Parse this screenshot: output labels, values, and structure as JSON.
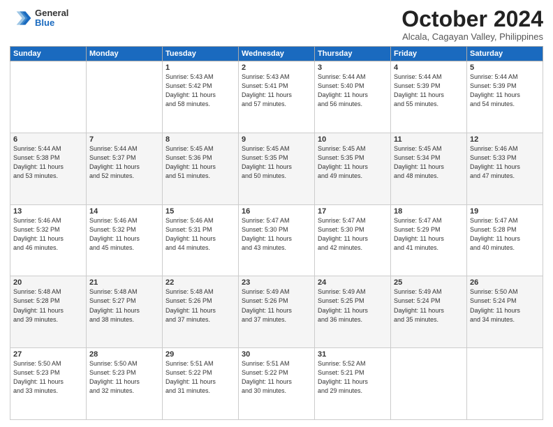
{
  "header": {
    "logo_general": "General",
    "logo_blue": "Blue",
    "month_title": "October 2024",
    "location": "Alcala, Cagayan Valley, Philippines"
  },
  "days_of_week": [
    "Sunday",
    "Monday",
    "Tuesday",
    "Wednesday",
    "Thursday",
    "Friday",
    "Saturday"
  ],
  "weeks": [
    [
      {
        "day": "",
        "info": ""
      },
      {
        "day": "",
        "info": ""
      },
      {
        "day": "1",
        "info": "Sunrise: 5:43 AM\nSunset: 5:42 PM\nDaylight: 11 hours\nand 58 minutes."
      },
      {
        "day": "2",
        "info": "Sunrise: 5:43 AM\nSunset: 5:41 PM\nDaylight: 11 hours\nand 57 minutes."
      },
      {
        "day": "3",
        "info": "Sunrise: 5:44 AM\nSunset: 5:40 PM\nDaylight: 11 hours\nand 56 minutes."
      },
      {
        "day": "4",
        "info": "Sunrise: 5:44 AM\nSunset: 5:39 PM\nDaylight: 11 hours\nand 55 minutes."
      },
      {
        "day": "5",
        "info": "Sunrise: 5:44 AM\nSunset: 5:39 PM\nDaylight: 11 hours\nand 54 minutes."
      }
    ],
    [
      {
        "day": "6",
        "info": "Sunrise: 5:44 AM\nSunset: 5:38 PM\nDaylight: 11 hours\nand 53 minutes."
      },
      {
        "day": "7",
        "info": "Sunrise: 5:44 AM\nSunset: 5:37 PM\nDaylight: 11 hours\nand 52 minutes."
      },
      {
        "day": "8",
        "info": "Sunrise: 5:45 AM\nSunset: 5:36 PM\nDaylight: 11 hours\nand 51 minutes."
      },
      {
        "day": "9",
        "info": "Sunrise: 5:45 AM\nSunset: 5:35 PM\nDaylight: 11 hours\nand 50 minutes."
      },
      {
        "day": "10",
        "info": "Sunrise: 5:45 AM\nSunset: 5:35 PM\nDaylight: 11 hours\nand 49 minutes."
      },
      {
        "day": "11",
        "info": "Sunrise: 5:45 AM\nSunset: 5:34 PM\nDaylight: 11 hours\nand 48 minutes."
      },
      {
        "day": "12",
        "info": "Sunrise: 5:46 AM\nSunset: 5:33 PM\nDaylight: 11 hours\nand 47 minutes."
      }
    ],
    [
      {
        "day": "13",
        "info": "Sunrise: 5:46 AM\nSunset: 5:32 PM\nDaylight: 11 hours\nand 46 minutes."
      },
      {
        "day": "14",
        "info": "Sunrise: 5:46 AM\nSunset: 5:32 PM\nDaylight: 11 hours\nand 45 minutes."
      },
      {
        "day": "15",
        "info": "Sunrise: 5:46 AM\nSunset: 5:31 PM\nDaylight: 11 hours\nand 44 minutes."
      },
      {
        "day": "16",
        "info": "Sunrise: 5:47 AM\nSunset: 5:30 PM\nDaylight: 11 hours\nand 43 minutes."
      },
      {
        "day": "17",
        "info": "Sunrise: 5:47 AM\nSunset: 5:30 PM\nDaylight: 11 hours\nand 42 minutes."
      },
      {
        "day": "18",
        "info": "Sunrise: 5:47 AM\nSunset: 5:29 PM\nDaylight: 11 hours\nand 41 minutes."
      },
      {
        "day": "19",
        "info": "Sunrise: 5:47 AM\nSunset: 5:28 PM\nDaylight: 11 hours\nand 40 minutes."
      }
    ],
    [
      {
        "day": "20",
        "info": "Sunrise: 5:48 AM\nSunset: 5:28 PM\nDaylight: 11 hours\nand 39 minutes."
      },
      {
        "day": "21",
        "info": "Sunrise: 5:48 AM\nSunset: 5:27 PM\nDaylight: 11 hours\nand 38 minutes."
      },
      {
        "day": "22",
        "info": "Sunrise: 5:48 AM\nSunset: 5:26 PM\nDaylight: 11 hours\nand 37 minutes."
      },
      {
        "day": "23",
        "info": "Sunrise: 5:49 AM\nSunset: 5:26 PM\nDaylight: 11 hours\nand 37 minutes."
      },
      {
        "day": "24",
        "info": "Sunrise: 5:49 AM\nSunset: 5:25 PM\nDaylight: 11 hours\nand 36 minutes."
      },
      {
        "day": "25",
        "info": "Sunrise: 5:49 AM\nSunset: 5:24 PM\nDaylight: 11 hours\nand 35 minutes."
      },
      {
        "day": "26",
        "info": "Sunrise: 5:50 AM\nSunset: 5:24 PM\nDaylight: 11 hours\nand 34 minutes."
      }
    ],
    [
      {
        "day": "27",
        "info": "Sunrise: 5:50 AM\nSunset: 5:23 PM\nDaylight: 11 hours\nand 33 minutes."
      },
      {
        "day": "28",
        "info": "Sunrise: 5:50 AM\nSunset: 5:23 PM\nDaylight: 11 hours\nand 32 minutes."
      },
      {
        "day": "29",
        "info": "Sunrise: 5:51 AM\nSunset: 5:22 PM\nDaylight: 11 hours\nand 31 minutes."
      },
      {
        "day": "30",
        "info": "Sunrise: 5:51 AM\nSunset: 5:22 PM\nDaylight: 11 hours\nand 30 minutes."
      },
      {
        "day": "31",
        "info": "Sunrise: 5:52 AM\nSunset: 5:21 PM\nDaylight: 11 hours\nand 29 minutes."
      },
      {
        "day": "",
        "info": ""
      },
      {
        "day": "",
        "info": ""
      }
    ]
  ]
}
